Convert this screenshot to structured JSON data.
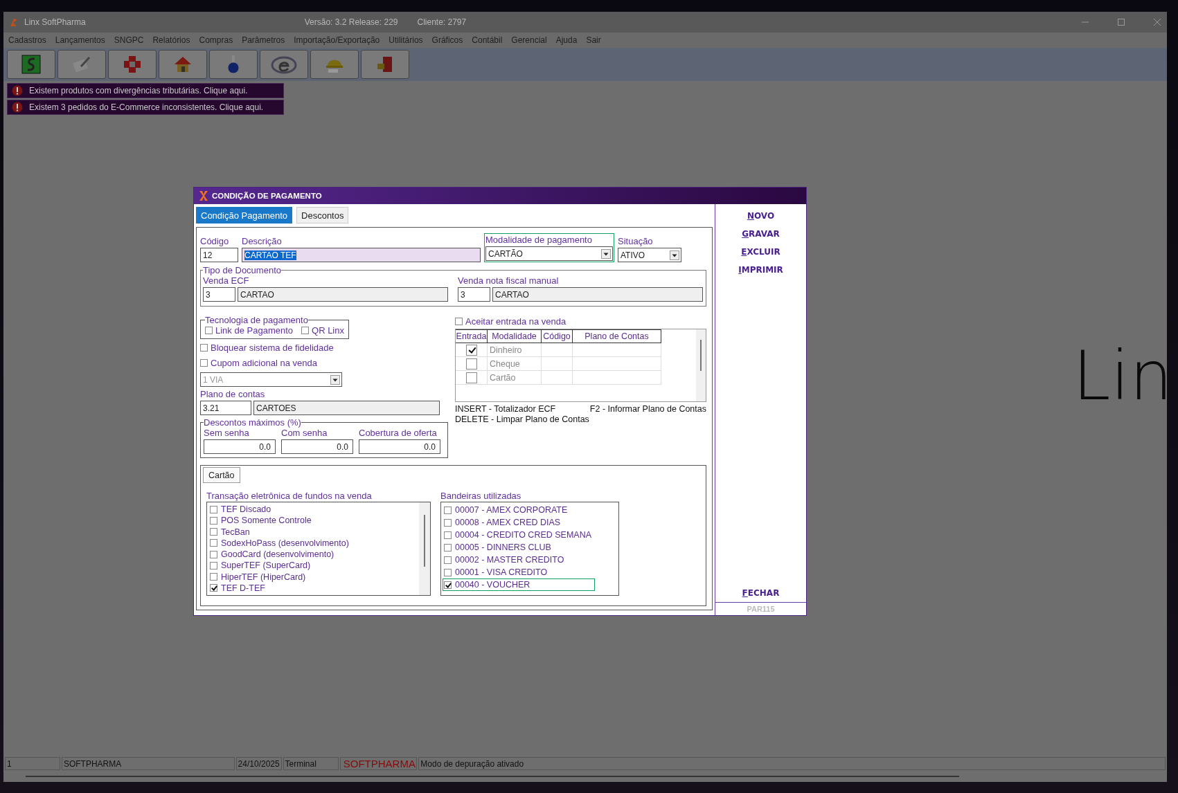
{
  "window": {
    "title": "Linx SoftPharma",
    "version": "Versão: 3.2 Release: 229",
    "client": "Cliente: 2797"
  },
  "menu": [
    "Cadastros",
    "Lançamentos",
    "SNGPC",
    "Relatórios",
    "Compras",
    "Parâmetros",
    "Importação/Exportação",
    "Utilitários",
    "Gráficos",
    "Contábil",
    "Gerencial",
    "Ajuda",
    "Sair"
  ],
  "notifications": [
    "Existem produtos com divergências tributárias. Clique aqui.",
    "Existem 3 pedidos do E-Commerce inconsistentes. Clique aqui."
  ],
  "background_logo": "Lin",
  "dialog": {
    "title": "CONDIÇÃO DE PAGAMENTO",
    "tabs": [
      {
        "label": "Condição Pagamento",
        "selected": true
      },
      {
        "label": "Descontos",
        "selected": false
      }
    ],
    "codigo": {
      "label": "Código",
      "value": "12"
    },
    "descricao": {
      "label": "Descrição",
      "value": "CARTAO TEF"
    },
    "modalidade": {
      "label": "Modalidade de pagamento",
      "value": "CARTÃO",
      "focused": true
    },
    "situacao": {
      "label": "Situação",
      "value": "ATIVO"
    },
    "tipo_documento": {
      "legend": "Tipo de Documento",
      "venda_ecf": {
        "label": "Venda ECF",
        "code": "3",
        "name": "CARTAO"
      },
      "venda_nota": {
        "label": "Venda nota fiscal manual",
        "code": "3",
        "name": "CARTAO"
      }
    },
    "tecnologia": {
      "legend": "Tecnologia de pagamento",
      "options": [
        {
          "label": "Link de Pagamento",
          "checked": false
        },
        {
          "label": "QR Linx",
          "checked": false
        }
      ]
    },
    "options": [
      {
        "label": "Bloquear sistema de fidelidade",
        "checked": false
      },
      {
        "label": "Cupom adicional na venda",
        "checked": false
      }
    ],
    "vias": {
      "value": "1 VIA",
      "disabled": true
    },
    "plano_contas": {
      "label": "Plano de contas",
      "code": "3.21",
      "name": "CARTOES"
    },
    "descontos": {
      "legend": "Descontos máximos (%)",
      "fields": [
        {
          "label": "Sem senha",
          "value": "0.0"
        },
        {
          "label": "Com senha",
          "value": "0.0"
        },
        {
          "label": "Cobertura de oferta",
          "value": "0.0"
        }
      ]
    },
    "aceitar_entrada": {
      "label": "Aceitar entrada na venda",
      "checked": false
    },
    "entrada_grid": {
      "columns": [
        "Entrada",
        "Modalidade",
        "Código",
        "Plano de Contas"
      ],
      "rows": [
        {
          "checked": true,
          "modalidade": "Dinheiro"
        },
        {
          "checked": false,
          "modalidade": "Cheque"
        },
        {
          "checked": false,
          "modalidade": "Cartão"
        }
      ]
    },
    "hints": [
      "INSERT - Totalizador ECF",
      "F2 - Informar Plano de Contas",
      "DELETE - Limpar Plano de Contas"
    ],
    "lower_tabs": [
      {
        "label": "Cartão",
        "selected": true
      }
    ],
    "tef": {
      "label": "Transação eletrônica de fundos na venda",
      "items": [
        {
          "label": "TEF Discado",
          "checked": false
        },
        {
          "label": "POS Somente Controle",
          "checked": false
        },
        {
          "label": "TecBan",
          "checked": false
        },
        {
          "label": "SodexHoPass (desenvolvimento)",
          "checked": false
        },
        {
          "label": "GoodCard (desenvolvimento)",
          "checked": false
        },
        {
          "label": "SuperTEF (SuperCard)",
          "checked": false
        },
        {
          "label": "HiperTEF (HiperCard)",
          "checked": false
        },
        {
          "label": "TEF D-TEF",
          "checked": true
        }
      ]
    },
    "bandeiras": {
      "label": "Bandeiras utilizadas",
      "items": [
        {
          "label": "00007 - AMEX CORPORATE",
          "checked": false,
          "focused": false
        },
        {
          "label": "00008 - AMEX CRED DIAS",
          "checked": false,
          "focused": false
        },
        {
          "label": "00004 - CREDITO CRED SEMANA",
          "checked": false,
          "focused": false
        },
        {
          "label": "00005 - DINNERS CLUB",
          "checked": false,
          "focused": false
        },
        {
          "label": "00002 - MASTER CREDITO",
          "checked": false,
          "focused": false
        },
        {
          "label": "00001 - VISA CREDITO",
          "checked": false,
          "focused": false
        },
        {
          "label": "00040 - VOUCHER",
          "checked": true,
          "focused": true
        }
      ]
    },
    "actions": [
      "NOVO",
      "GRAVAR",
      "EXCLUIR",
      "IMPRIMIR"
    ],
    "close": "FECHAR",
    "screen_code": "PAR115"
  },
  "status_bar": [
    {
      "text": "1",
      "kind": "plain"
    },
    {
      "text": "SOFTPHARMA",
      "kind": "plain"
    },
    {
      "text": "24/10/2025",
      "kind": "plain"
    },
    {
      "text": "Terminal",
      "kind": "plain"
    },
    {
      "text": "SOFTPHARMA",
      "kind": "brand"
    },
    {
      "text": "Modo de depuração ativado",
      "kind": "plain"
    }
  ]
}
